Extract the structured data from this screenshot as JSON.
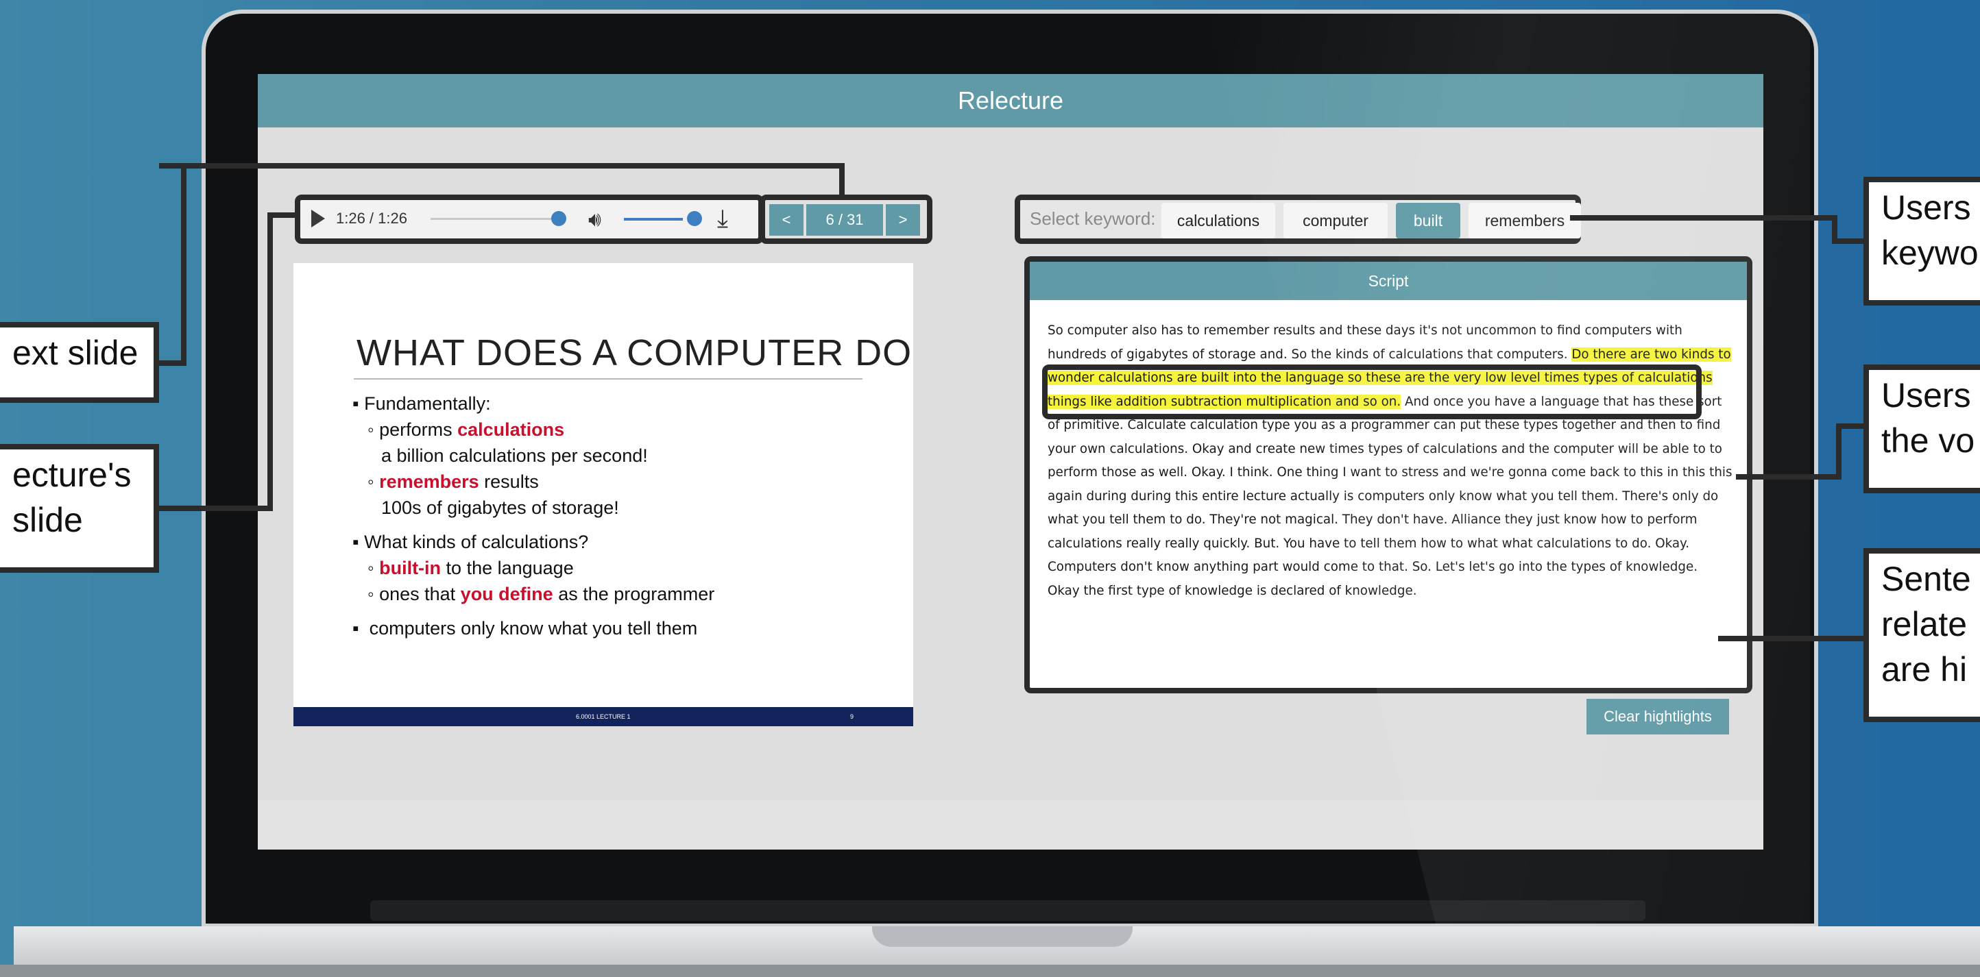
{
  "app": {
    "title": "Relecture"
  },
  "player": {
    "time": "1:26 / 1:26",
    "progress": 1.0,
    "volume": 1.0
  },
  "pager": {
    "prev": "<",
    "page": "6 / 31",
    "next": ">"
  },
  "slide": {
    "title": "WHAT DOES A COMPUTER DO",
    "lines": {
      "l1": "Fundamentally:",
      "l2a": "performs ",
      "l2b": "calculations",
      "l3": "a billion calculations per second!",
      "l4a": "remembers",
      "l4b": " results",
      "l5": "100s of gigabytes of storage!",
      "l6": "What kinds of calculations?",
      "l7a": "built-in",
      "l7b": " to the language",
      "l8a": "ones that ",
      "l8b": "you define",
      "l8c": " as the programmer",
      "l9": "computers only know what you tell them"
    },
    "footer_center": "6.0001 LECTURE 1",
    "footer_page": "9"
  },
  "keywords": {
    "label": "Select keyword:",
    "items": [
      "calculations",
      "computer",
      "built",
      "remembers"
    ],
    "selected": "built"
  },
  "script": {
    "header": "Script",
    "pre": "So computer also has to remember results and these days it's not uncommon to find computers with hundreds of gigabytes of storage and. So the kinds of calculations that computers. ",
    "highlight": "Do there are two kinds to wonder calculations are built into the language so these are the very low level times types of calculations things like addition subtraction multiplication and so on.",
    "post": " And once you have a language that has these sort of primitive. Calculate calculation type you as a programmer can put these types together and then to find your own calculations. Okay and create new times types of calculations and the computer will be able to to perform those as well. Okay. I think. One thing I want to stress and we're gonna come back to this in this this again during during this entire lecture actually is computers only know what you tell them. There's only do what you tell them to do. They're not magical. They don't have. Alliance they just know how to perform calculations really really quickly. But. You have to tell them how to what what calculations to do. Okay. Computers don't know anything part would come to that. So. Let's let's go into the types of knowledge. Okay the first type of knowledge is declared of knowledge."
  },
  "clear_button": "Clear hightlights",
  "callouts": {
    "next_slide": "ext  slide",
    "lecture_slide_1": "ecture's",
    "lecture_slide_2": "slide",
    "keyword_1": "Users",
    "keyword_2": "keywo",
    "voice_1": "Users",
    "voice_2": "the vo",
    "sentence_1": "Sente",
    "sentence_2": "relate",
    "sentence_3": "are hi"
  }
}
